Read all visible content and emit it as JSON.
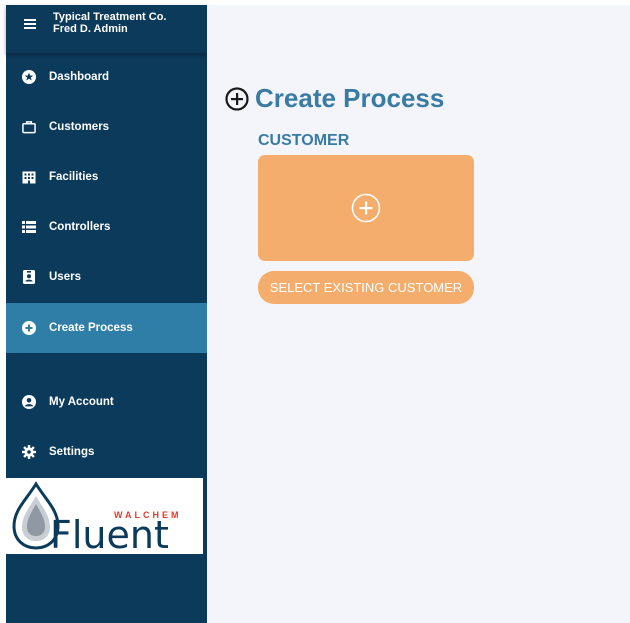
{
  "header": {
    "org_name": "Typical Treatment Co.",
    "user_name": "Fred D. Admin"
  },
  "sidebar": {
    "items": [
      {
        "label": "Dashboard",
        "icon": "star-circle-icon"
      },
      {
        "label": "Customers",
        "icon": "briefcase-icon"
      },
      {
        "label": "Facilities",
        "icon": "building-icon"
      },
      {
        "label": "Controllers",
        "icon": "list-icon"
      },
      {
        "label": "Users",
        "icon": "id-badge-icon"
      },
      {
        "label": "Create Process",
        "icon": "plus-circle-icon",
        "active": true
      },
      {
        "label": "My Account",
        "icon": "user-circle-icon"
      },
      {
        "label": "Settings",
        "icon": "gear-icon"
      }
    ],
    "logo": {
      "brand_top": "WALCHEM",
      "brand_main": "Fluent"
    }
  },
  "main": {
    "title": "Create Process",
    "section_label": "CUSTOMER",
    "select_button": "SELECT EXISTING CUSTOMER"
  },
  "colors": {
    "sidebar_bg": "#0b3a5b",
    "active_item": "#2e7ea8",
    "title_blue": "#3a7ba4",
    "accent_orange": "#f4ad6c",
    "main_bg": "#f3f5fa"
  }
}
